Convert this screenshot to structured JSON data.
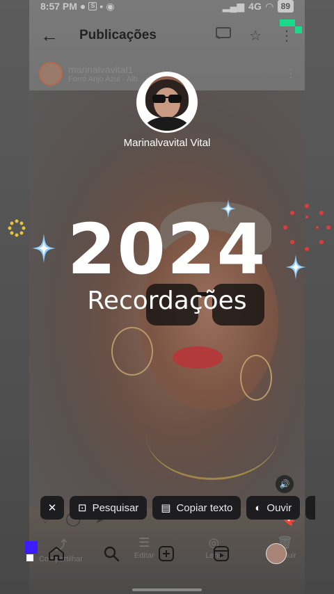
{
  "status_bar": {
    "time": "8:57 PM",
    "network": "4G",
    "battery": "89"
  },
  "top_bar": {
    "title": "Publicações",
    "icons": [
      "back-arrow-icon",
      "cast-icon",
      "star-icon",
      "more-vert-icon"
    ]
  },
  "post": {
    "username": "marinalvavital1",
    "subtitle": "Forró Anjo Azul · Alb... da Amor"
  },
  "recap": {
    "name": "Marinalvavital Vital",
    "year": "2024",
    "subtitle": "Recordações"
  },
  "lens_bar": {
    "close_icon": "close-icon",
    "buttons": [
      {
        "label": "Pesquisar",
        "icon": "lens-search-icon"
      },
      {
        "label": "Copiar texto",
        "icon": "copy-text-icon"
      },
      {
        "label": "Ouvir",
        "icon": "listen-icon"
      }
    ]
  },
  "action_row": {
    "items": [
      {
        "label": "Compartilhar",
        "icon": "share-icon"
      },
      {
        "label": "Editar",
        "icon": "edit-icon"
      },
      {
        "label": "Lens",
        "icon": "lens-icon"
      },
      {
        "label": "Excluir",
        "icon": "delete-icon"
      }
    ]
  },
  "bottom_nav": {
    "items": [
      "home-icon",
      "search-icon",
      "add-icon",
      "reels-icon",
      "profile-avatar"
    ]
  },
  "colors": {
    "sparkle_blue": "#8fd0ff",
    "sparkle_gold": "#e8c23a",
    "sparkle_red": "#e23a3a",
    "chip_bg": "#1d1d1f",
    "marker_green": "#19d98b",
    "marker_blue": "#3b1cff"
  }
}
